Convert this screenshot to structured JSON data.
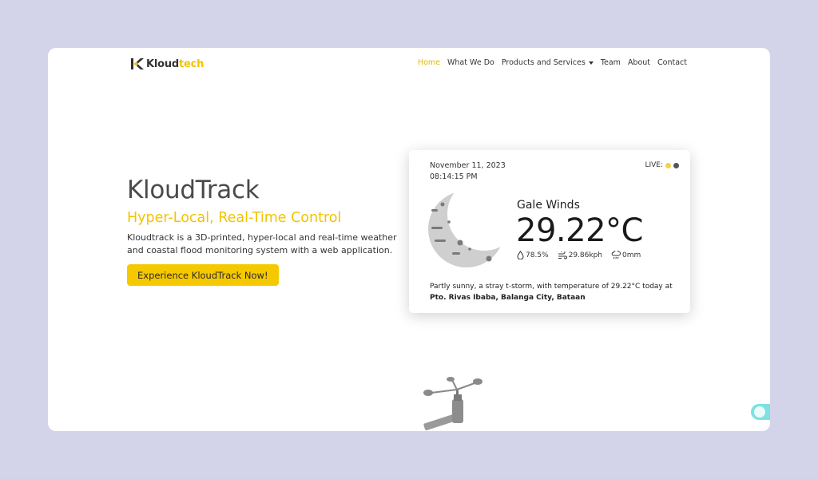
{
  "brand": {
    "name_part1": "Kloud",
    "name_part2": "tech"
  },
  "nav": {
    "items": [
      {
        "label": "Home",
        "active": true
      },
      {
        "label": "What We Do"
      },
      {
        "label": "Products and Services",
        "dropdown": true
      },
      {
        "label": "Team"
      },
      {
        "label": "About"
      },
      {
        "label": "Contact"
      }
    ]
  },
  "hero": {
    "title": "KloudTrack",
    "subtitle": "Hyper-Local, Real-Time Control",
    "description": "Kloudtrack is a 3D-printed, hyper-local and real-time weather and coastal flood monitoring system with a web application.",
    "cta_label": "Experience KloudTrack Now!"
  },
  "weather": {
    "date": "November 11, 2023",
    "time": "08:14:15 PM",
    "live_label": "LIVE:",
    "condition": "Gale Winds",
    "temperature": "29.22°C",
    "humidity": "78.5%",
    "wind": "29.86kph",
    "rain": "0mm",
    "summary_text": "Partly sunny, a stray t-storm, with temperature of 29.22°C today at ",
    "summary_location": "Pto. Rivas Ibaba, Balanga City, Bataan"
  },
  "colors": {
    "accent": "#f2c300",
    "background": "#d3d3ea",
    "live_dot_1": "#f2d24a",
    "live_dot_2": "#555555"
  },
  "icons": [
    "logo-icon",
    "caret-down-icon",
    "moon-icon",
    "droplet-icon",
    "wind-icon",
    "rain-icon",
    "weather-station-image",
    "toggle-switch"
  ]
}
